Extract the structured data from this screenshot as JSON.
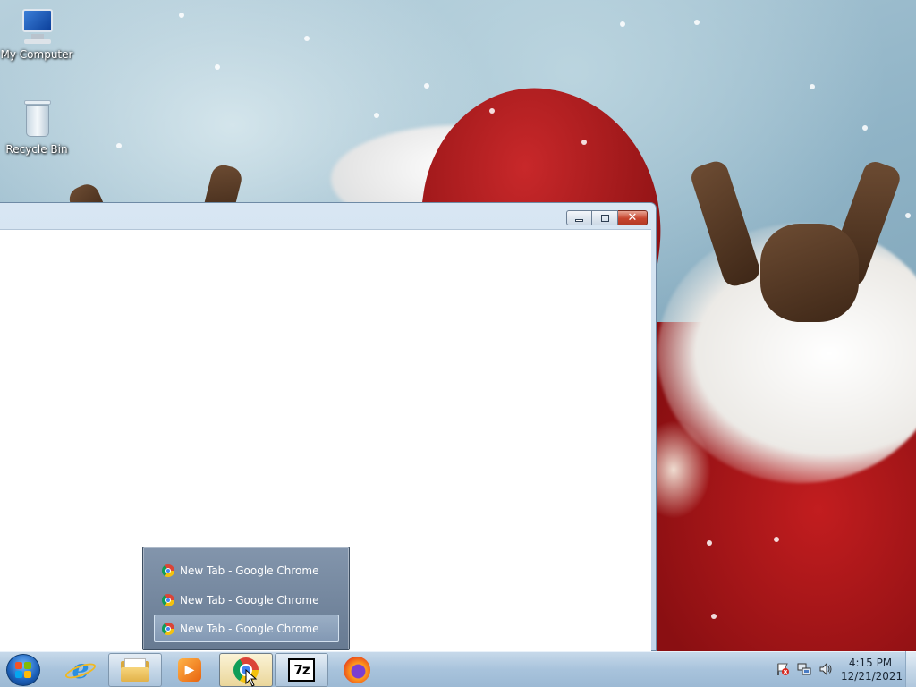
{
  "desktop": {
    "icons": [
      {
        "label": "My Computer",
        "icon": "computer-icon"
      },
      {
        "label": "Recycle Bin",
        "icon": "recycle-bin-icon"
      }
    ]
  },
  "window": {
    "controls": [
      "minimize",
      "maximize",
      "close"
    ]
  },
  "taskbar": {
    "start": {
      "icon": "windows-orb-icon"
    },
    "items": [
      {
        "name": "internet-explorer",
        "icon": "internet-explorer-icon",
        "state": "pinned"
      },
      {
        "name": "windows-explorer",
        "icon": "folder-icon",
        "state": "running"
      },
      {
        "name": "windows-media-player",
        "icon": "media-player-icon",
        "state": "pinned"
      },
      {
        "name": "google-chrome",
        "icon": "chrome-icon",
        "state": "active"
      },
      {
        "name": "7-zip",
        "icon": "7zip-icon",
        "state": "running",
        "label": "7z"
      },
      {
        "name": "firefox",
        "icon": "firefox-icon",
        "state": "pinned"
      }
    ]
  },
  "jumplist": {
    "items": [
      {
        "label": "New Tab - Google Chrome",
        "selected": false
      },
      {
        "label": "New Tab - Google Chrome",
        "selected": false
      },
      {
        "label": "New Tab - Google Chrome",
        "selected": true
      }
    ]
  },
  "tray": {
    "icons": [
      "action-center-flag-icon",
      "network-icon",
      "volume-icon"
    ],
    "time": "4:15 PM",
    "date": "12/21/2021"
  },
  "colors": {
    "taskbar": "#a8c3dc",
    "active_button": "#ead69a",
    "close_button": "#c7452e"
  }
}
